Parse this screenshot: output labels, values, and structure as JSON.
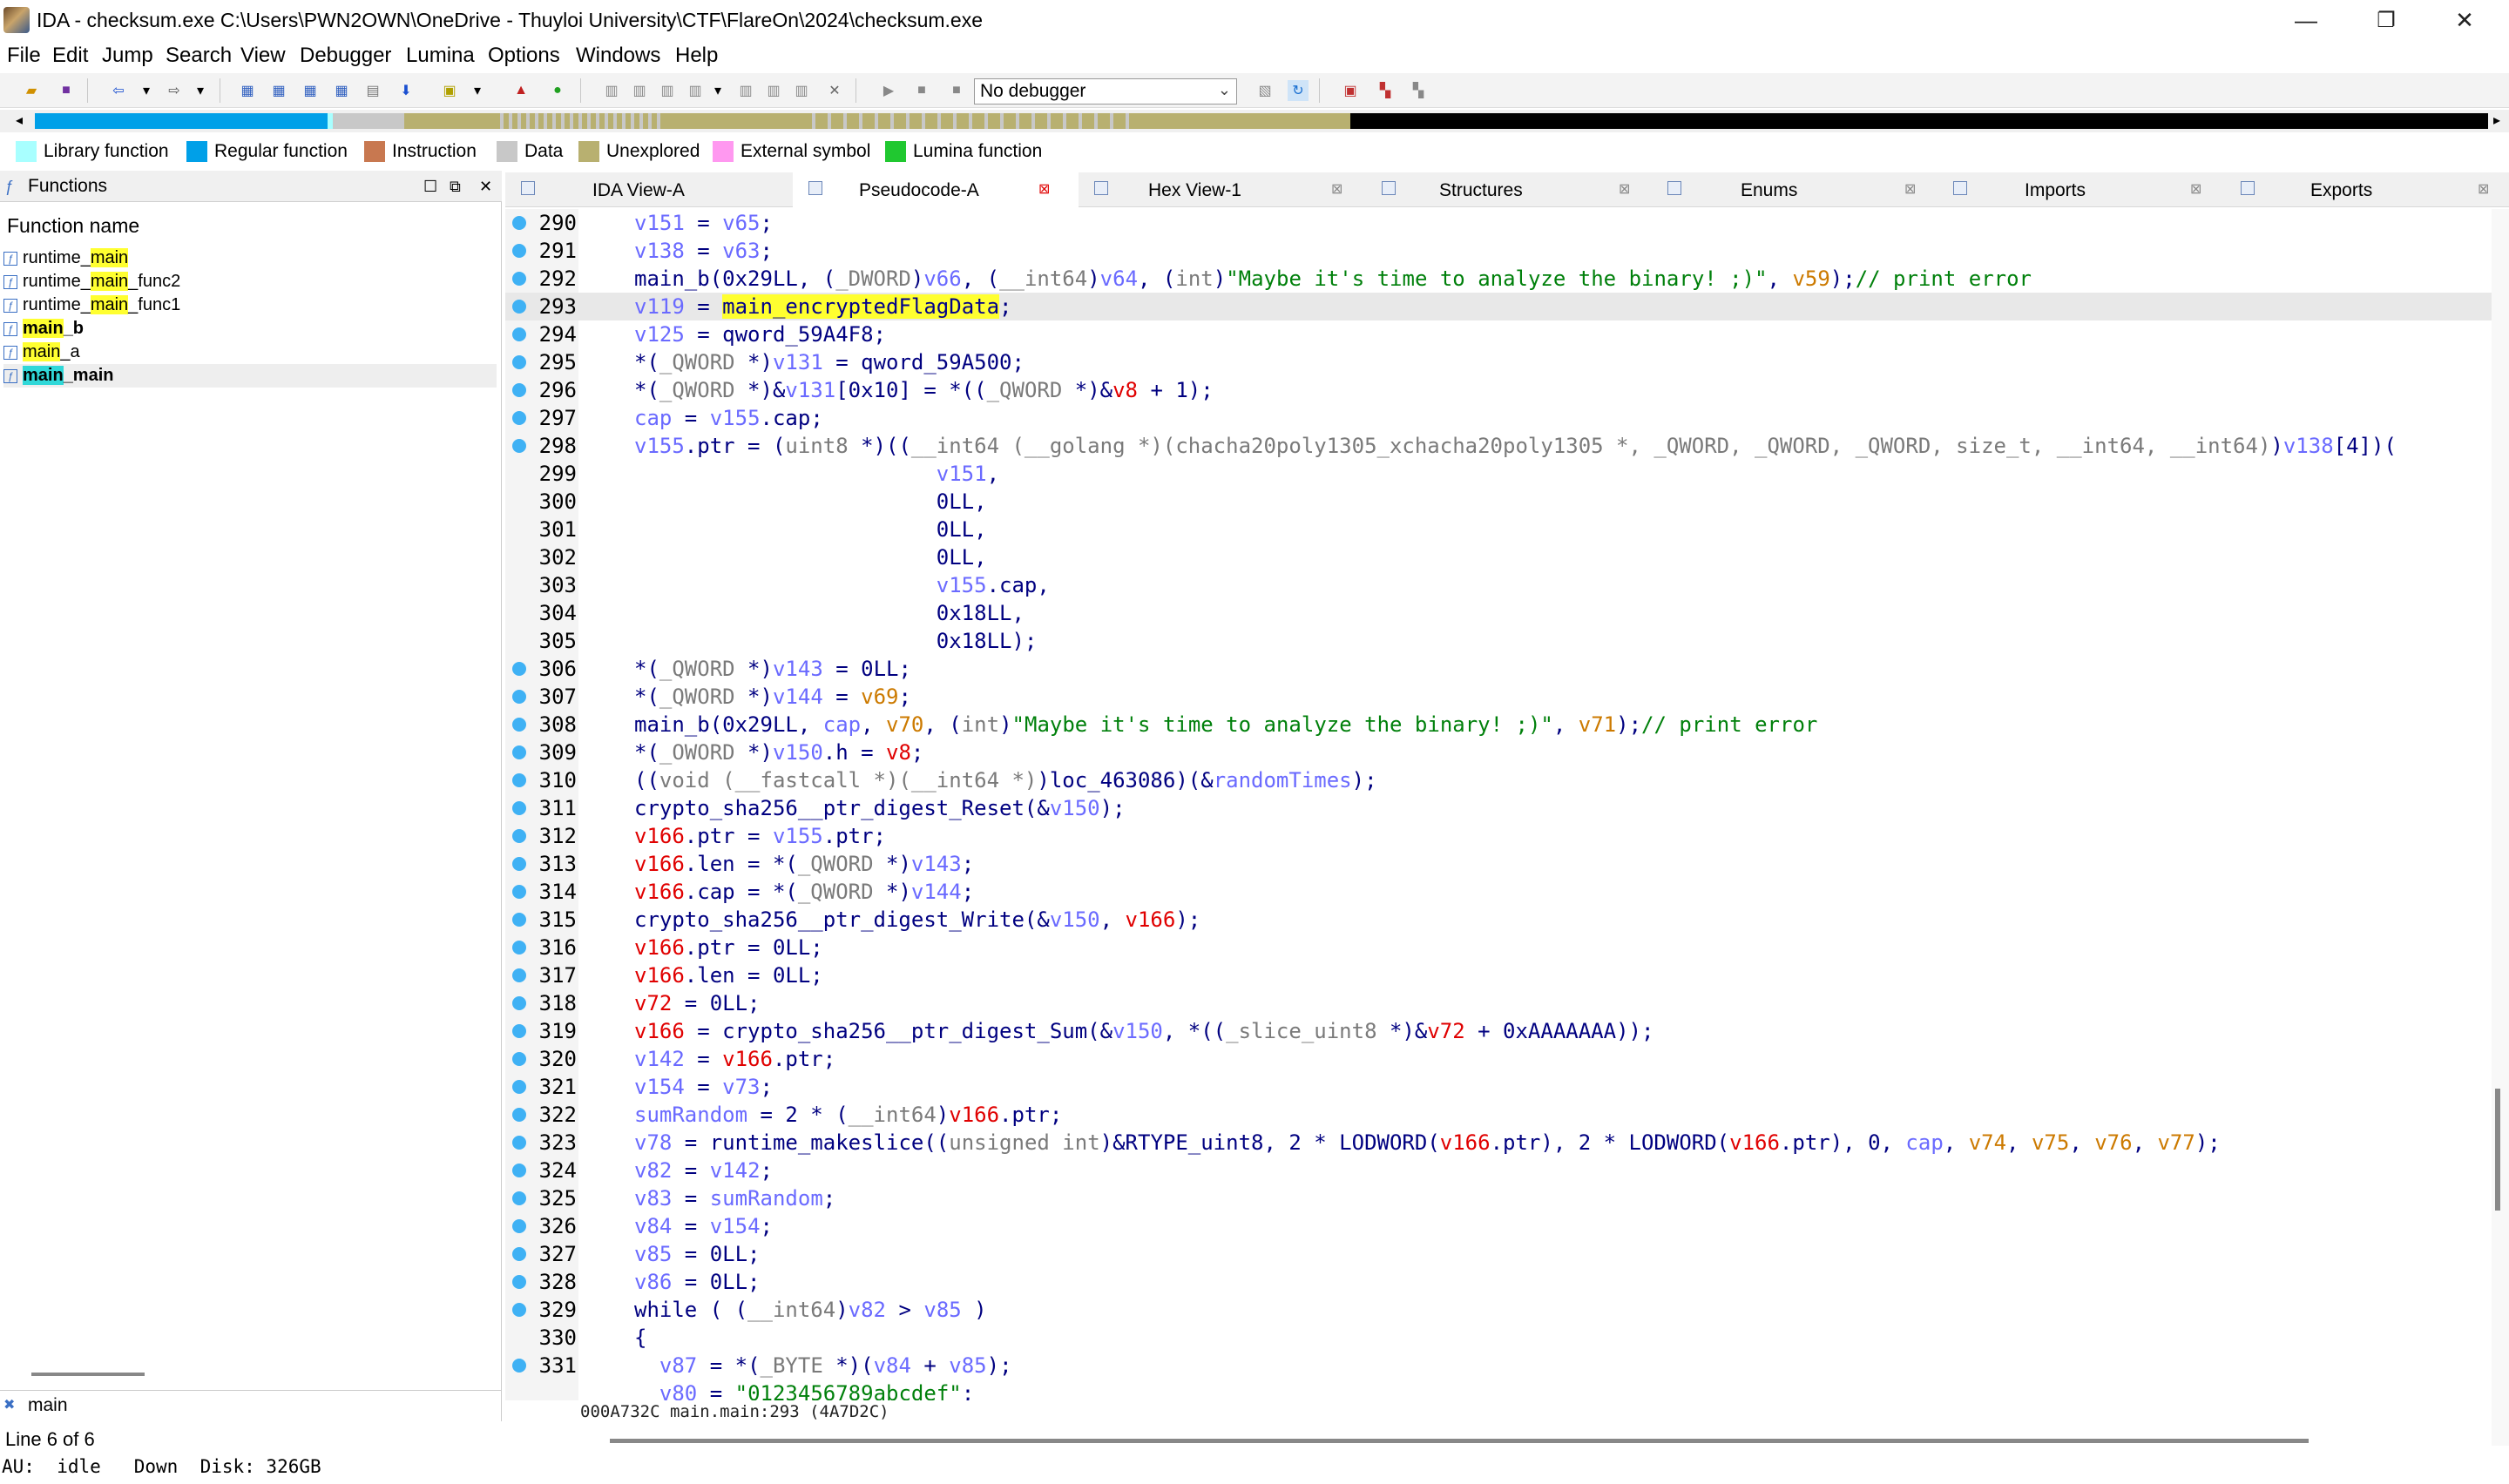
{
  "window": {
    "title": "IDA - checksum.exe C:\\Users\\PWN2OWN\\OneDrive - Thuyloi University\\CTF\\FlareOn\\2024\\checksum.exe",
    "minimize": "—",
    "restore": "❐",
    "close": "✕"
  },
  "menu": [
    "File",
    "Edit",
    "Jump",
    "Search",
    "View",
    "Debugger",
    "Lumina",
    "Options",
    "Windows",
    "Help"
  ],
  "toolbar": {
    "debugger": "No debugger"
  },
  "legend": [
    {
      "label": "Library function",
      "color": "#a8ffff"
    },
    {
      "label": "Regular function",
      "color": "#00a0e8"
    },
    {
      "label": "Instruction",
      "color": "#c87850"
    },
    {
      "label": "Data",
      "color": "#c8c8c8"
    },
    {
      "label": "Unexplored",
      "color": "#b8b070"
    },
    {
      "label": "External symbol",
      "color": "#ff98f0"
    },
    {
      "label": "Lumina function",
      "color": "#20c830"
    }
  ],
  "functions_panel": {
    "title": "Functions",
    "column": "Function name",
    "items": [
      {
        "pre": "runtime_",
        "hl": "main",
        "post": "",
        "bold": false,
        "hlcolor": "y"
      },
      {
        "pre": "runtime_",
        "hl": "main",
        "post": "_func2",
        "bold": false,
        "hlcolor": "y"
      },
      {
        "pre": "runtime_",
        "hl": "main",
        "post": "_func1",
        "bold": false,
        "hlcolor": "y"
      },
      {
        "pre": "",
        "hl": "main",
        "post": "_b",
        "bold": true,
        "hlcolor": "y"
      },
      {
        "pre": "",
        "hl": "main",
        "post": "_a",
        "bold": false,
        "hlcolor": "y"
      },
      {
        "pre": "",
        "hl": "main",
        "post": "_main",
        "bold": true,
        "hlcolor": "c"
      }
    ],
    "filter": "main"
  },
  "status": {
    "line": "Line 6 of 6",
    "au": "AU:  idle   Down  Disk: 326GB"
  },
  "tabs": [
    "IDA View-A",
    "Pseudocode-A",
    "Hex View-1",
    "Structures",
    "Enums",
    "Imports",
    "Exports"
  ],
  "active_tab": 1,
  "code_status": "000A732C main.main:293 (4A7D2C)",
  "code_lines": [
    {
      "n": "290",
      "dot": true,
      "t": [
        [
          "v",
          "v151"
        ],
        [
          "k",
          " = "
        ],
        [
          "v",
          "v65"
        ],
        [
          "k",
          ";"
        ]
      ]
    },
    {
      "n": "291",
      "dot": true,
      "t": [
        [
          "v",
          "v138"
        ],
        [
          "k",
          " = "
        ],
        [
          "v",
          "v63"
        ],
        [
          "k",
          ";"
        ]
      ]
    },
    {
      "n": "292",
      "dot": true,
      "t": [
        [
          "k",
          "main_b(0x29LL, ("
        ],
        [
          "g",
          "_DWORD"
        ],
        [
          "k",
          ")"
        ],
        [
          "v",
          "v66"
        ],
        [
          "k",
          ", ("
        ],
        [
          "g",
          "__int64"
        ],
        [
          "k",
          ")"
        ],
        [
          "v",
          "v64"
        ],
        [
          "k",
          ", ("
        ],
        [
          "g",
          "int"
        ],
        [
          "k",
          ")"
        ],
        [
          "s",
          "\"Maybe it's time to analyze the binary! ;)\""
        ],
        [
          "k",
          ", "
        ],
        [
          "o",
          "v59"
        ],
        [
          "k",
          ");"
        ],
        [
          "s",
          "// print error"
        ]
      ]
    },
    {
      "n": "293",
      "dot": true,
      "cur": true,
      "t": [
        [
          "v",
          "v119"
        ],
        [
          "k",
          " = "
        ],
        [
          "hl",
          "main_encryptedFlagData"
        ],
        [
          "k",
          ";"
        ]
      ]
    },
    {
      "n": "294",
      "dot": true,
      "t": [
        [
          "v",
          "v125"
        ],
        [
          "k",
          " = qword_59A4F8;"
        ]
      ]
    },
    {
      "n": "295",
      "dot": true,
      "t": [
        [
          "k",
          "*("
        ],
        [
          "g",
          "_QWORD"
        ],
        [
          "k",
          " *)"
        ],
        [
          "v",
          "v131"
        ],
        [
          "k",
          " = qword_59A500;"
        ]
      ]
    },
    {
      "n": "296",
      "dot": true,
      "t": [
        [
          "k",
          "*("
        ],
        [
          "g",
          "_QWORD"
        ],
        [
          "k",
          " *)&"
        ],
        [
          "v",
          "v131"
        ],
        [
          "k",
          "[0x10] = *(("
        ],
        [
          "g",
          "_QWORD"
        ],
        [
          "k",
          " *)&"
        ],
        [
          "r",
          "v8"
        ],
        [
          "k",
          " + 1);"
        ]
      ]
    },
    {
      "n": "297",
      "dot": true,
      "t": [
        [
          "v",
          "cap"
        ],
        [
          "k",
          " = "
        ],
        [
          "v",
          "v155"
        ],
        [
          "k",
          ".cap;"
        ]
      ]
    },
    {
      "n": "298",
      "dot": true,
      "t": [
        [
          "v",
          "v155"
        ],
        [
          "k",
          ".ptr = ("
        ],
        [
          "g",
          "uint8"
        ],
        [
          "k",
          " *)(("
        ],
        [
          "g",
          "__int64 (__golang *)(chacha20poly1305_xchacha20poly1305 *, _QWORD, _QWORD, _QWORD, size_t, __int64, __int64)"
        ],
        [
          "k",
          ")"
        ],
        [
          "v",
          "v138"
        ],
        [
          "k",
          "[4])("
        ]
      ]
    },
    {
      "n": "299",
      "dot": false,
      "t": [
        [
          "k",
          "                        "
        ],
        [
          "v",
          "v151"
        ],
        [
          "k",
          ","
        ]
      ]
    },
    {
      "n": "300",
      "dot": false,
      "t": [
        [
          "k",
          "                        0LL,"
        ]
      ]
    },
    {
      "n": "301",
      "dot": false,
      "t": [
        [
          "k",
          "                        0LL,"
        ]
      ]
    },
    {
      "n": "302",
      "dot": false,
      "t": [
        [
          "k",
          "                        0LL,"
        ]
      ]
    },
    {
      "n": "303",
      "dot": false,
      "t": [
        [
          "k",
          "                        "
        ],
        [
          "v",
          "v155"
        ],
        [
          "k",
          ".cap,"
        ]
      ]
    },
    {
      "n": "304",
      "dot": false,
      "t": [
        [
          "k",
          "                        0x18LL,"
        ]
      ]
    },
    {
      "n": "305",
      "dot": false,
      "t": [
        [
          "k",
          "                        0x18LL);"
        ]
      ]
    },
    {
      "n": "306",
      "dot": true,
      "t": [
        [
          "k",
          "*("
        ],
        [
          "g",
          "_QWORD"
        ],
        [
          "k",
          " *)"
        ],
        [
          "v",
          "v143"
        ],
        [
          "k",
          " = 0LL;"
        ]
      ]
    },
    {
      "n": "307",
      "dot": true,
      "t": [
        [
          "k",
          "*("
        ],
        [
          "g",
          "_QWORD"
        ],
        [
          "k",
          " *)"
        ],
        [
          "v",
          "v144"
        ],
        [
          "k",
          " = "
        ],
        [
          "o",
          "v69"
        ],
        [
          "k",
          ";"
        ]
      ]
    },
    {
      "n": "308",
      "dot": true,
      "t": [
        [
          "k",
          "main_b(0x29LL, "
        ],
        [
          "v",
          "cap"
        ],
        [
          "k",
          ", "
        ],
        [
          "o",
          "v70"
        ],
        [
          "k",
          ", ("
        ],
        [
          "g",
          "int"
        ],
        [
          "k",
          ")"
        ],
        [
          "s",
          "\"Maybe it's time to analyze the binary! ;)\""
        ],
        [
          "k",
          ", "
        ],
        [
          "o",
          "v71"
        ],
        [
          "k",
          ");"
        ],
        [
          "s",
          "// print error"
        ]
      ]
    },
    {
      "n": "309",
      "dot": true,
      "t": [
        [
          "k",
          "*("
        ],
        [
          "g",
          "_OWORD"
        ],
        [
          "k",
          " *)"
        ],
        [
          "v",
          "v150"
        ],
        [
          "k",
          ".h = "
        ],
        [
          "r",
          "v8"
        ],
        [
          "k",
          ";"
        ]
      ]
    },
    {
      "n": "310",
      "dot": true,
      "t": [
        [
          "k",
          "(("
        ],
        [
          "g",
          "void (__fastcall *)(__int64 *)"
        ],
        [
          "k",
          ")loc_463086)(&"
        ],
        [
          "v",
          "randomTimes"
        ],
        [
          "k",
          ");"
        ]
      ]
    },
    {
      "n": "311",
      "dot": true,
      "t": [
        [
          "k",
          "crypto_sha256__ptr_digest_Reset(&"
        ],
        [
          "v",
          "v150"
        ],
        [
          "k",
          ");"
        ]
      ]
    },
    {
      "n": "312",
      "dot": true,
      "t": [
        [
          "r",
          "v166"
        ],
        [
          "k",
          ".ptr = "
        ],
        [
          "v",
          "v155"
        ],
        [
          "k",
          ".ptr;"
        ]
      ]
    },
    {
      "n": "313",
      "dot": true,
      "t": [
        [
          "r",
          "v166"
        ],
        [
          "k",
          ".len = *("
        ],
        [
          "g",
          "_QWORD"
        ],
        [
          "k",
          " *)"
        ],
        [
          "v",
          "v143"
        ],
        [
          "k",
          ";"
        ]
      ]
    },
    {
      "n": "314",
      "dot": true,
      "t": [
        [
          "r",
          "v166"
        ],
        [
          "k",
          ".cap = *("
        ],
        [
          "g",
          "_QWORD"
        ],
        [
          "k",
          " *)"
        ],
        [
          "v",
          "v144"
        ],
        [
          "k",
          ";"
        ]
      ]
    },
    {
      "n": "315",
      "dot": true,
      "t": [
        [
          "k",
          "crypto_sha256__ptr_digest_Write(&"
        ],
        [
          "v",
          "v150"
        ],
        [
          "k",
          ", "
        ],
        [
          "r",
          "v166"
        ],
        [
          "k",
          ");"
        ]
      ]
    },
    {
      "n": "316",
      "dot": true,
      "t": [
        [
          "r",
          "v166"
        ],
        [
          "k",
          ".ptr = 0LL;"
        ]
      ]
    },
    {
      "n": "317",
      "dot": true,
      "t": [
        [
          "r",
          "v166"
        ],
        [
          "k",
          ".len = 0LL;"
        ]
      ]
    },
    {
      "n": "318",
      "dot": true,
      "t": [
        [
          "r",
          "v72"
        ],
        [
          "k",
          " = 0LL;"
        ]
      ]
    },
    {
      "n": "319",
      "dot": true,
      "t": [
        [
          "r",
          "v166"
        ],
        [
          "k",
          " = crypto_sha256__ptr_digest_Sum(&"
        ],
        [
          "v",
          "v150"
        ],
        [
          "k",
          ", *(("
        ],
        [
          "g",
          "_slice_uint8"
        ],
        [
          "k",
          " *)&"
        ],
        [
          "r",
          "v72"
        ],
        [
          "k",
          " + 0xAAAAAAA));"
        ]
      ]
    },
    {
      "n": "320",
      "dot": true,
      "t": [
        [
          "v",
          "v142"
        ],
        [
          "k",
          " = "
        ],
        [
          "r",
          "v166"
        ],
        [
          "k",
          ".ptr;"
        ]
      ]
    },
    {
      "n": "321",
      "dot": true,
      "t": [
        [
          "v",
          "v154"
        ],
        [
          "k",
          " = "
        ],
        [
          "v",
          "v73"
        ],
        [
          "k",
          ";"
        ]
      ]
    },
    {
      "n": "322",
      "dot": true,
      "t": [
        [
          "v",
          "sumRandom"
        ],
        [
          "k",
          " = 2 * ("
        ],
        [
          "g",
          "__int64"
        ],
        [
          "k",
          ")"
        ],
        [
          "r",
          "v166"
        ],
        [
          "k",
          ".ptr;"
        ]
      ]
    },
    {
      "n": "323",
      "dot": true,
      "t": [
        [
          "v",
          "v78"
        ],
        [
          "k",
          " = runtime_makeslice(("
        ],
        [
          "g",
          "unsigned int"
        ],
        [
          "k",
          ")&RTYPE_uint8, 2 * LODWORD("
        ],
        [
          "r",
          "v166"
        ],
        [
          "k",
          ".ptr), 2 * LODWORD("
        ],
        [
          "r",
          "v166"
        ],
        [
          "k",
          ".ptr), 0, "
        ],
        [
          "v",
          "cap"
        ],
        [
          "k",
          ", "
        ],
        [
          "o",
          "v74"
        ],
        [
          "k",
          ", "
        ],
        [
          "o",
          "v75"
        ],
        [
          "k",
          ", "
        ],
        [
          "o",
          "v76"
        ],
        [
          "k",
          ", "
        ],
        [
          "o",
          "v77"
        ],
        [
          "k",
          ");"
        ]
      ]
    },
    {
      "n": "324",
      "dot": true,
      "t": [
        [
          "v",
          "v82"
        ],
        [
          "k",
          " = "
        ],
        [
          "v",
          "v142"
        ],
        [
          "k",
          ";"
        ]
      ]
    },
    {
      "n": "325",
      "dot": true,
      "t": [
        [
          "v",
          "v83"
        ],
        [
          "k",
          " = "
        ],
        [
          "v",
          "sumRandom"
        ],
        [
          "k",
          ";"
        ]
      ]
    },
    {
      "n": "326",
      "dot": true,
      "t": [
        [
          "v",
          "v84"
        ],
        [
          "k",
          " = "
        ],
        [
          "v",
          "v154"
        ],
        [
          "k",
          ";"
        ]
      ]
    },
    {
      "n": "327",
      "dot": true,
      "t": [
        [
          "v",
          "v85"
        ],
        [
          "k",
          " = 0LL;"
        ]
      ]
    },
    {
      "n": "328",
      "dot": true,
      "t": [
        [
          "v",
          "v86"
        ],
        [
          "k",
          " = 0LL;"
        ]
      ]
    },
    {
      "n": "329",
      "dot": true,
      "t": [
        [
          "k",
          "while ( ("
        ],
        [
          "g",
          "__int64"
        ],
        [
          "k",
          ")"
        ],
        [
          "v",
          "v82"
        ],
        [
          "k",
          " > "
        ],
        [
          "v",
          "v85"
        ],
        [
          "k",
          " )"
        ]
      ]
    },
    {
      "n": "330",
      "dot": false,
      "t": [
        [
          "k",
          "{"
        ]
      ]
    },
    {
      "n": "331",
      "dot": true,
      "t": [
        [
          "k",
          "  "
        ],
        [
          "v",
          "v87"
        ],
        [
          "k",
          " = *("
        ],
        [
          "g",
          "_BYTE"
        ],
        [
          "k",
          " *)("
        ],
        [
          "v",
          "v84"
        ],
        [
          "k",
          " + "
        ],
        [
          "v",
          "v85"
        ],
        [
          "k",
          ");"
        ]
      ]
    },
    {
      "n": "",
      "dot": false,
      "t": [
        [
          "k",
          "  "
        ],
        [
          "v",
          "v80"
        ],
        [
          "k",
          " = "
        ],
        [
          "s",
          "\"0123456789abcdef\""
        ],
        [
          "k",
          ";"
        ]
      ]
    }
  ]
}
